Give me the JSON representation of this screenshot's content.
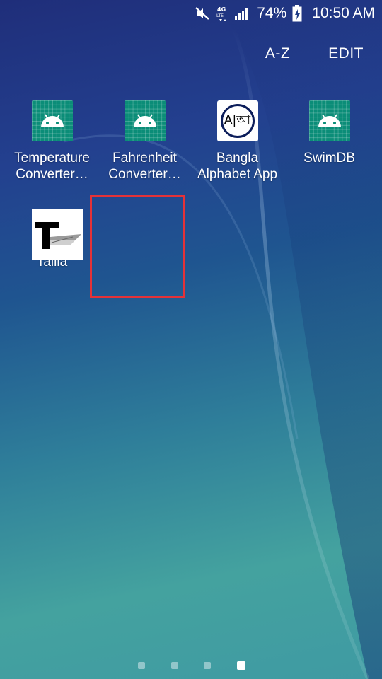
{
  "status_bar": {
    "mute_icon": "mute-icon",
    "network_label": "4G LTE",
    "signal_icon": "signal-icon",
    "battery_percent": "74%",
    "battery_icon": "battery-charging-icon",
    "time": "10:50 AM"
  },
  "top_actions": {
    "sort_label": "A-Z",
    "edit_label": "EDIT"
  },
  "apps": [
    {
      "line1": "Temperature",
      "line2": "Converter…",
      "icon": "android-icon"
    },
    {
      "line1": "Fahrenheit",
      "line2": "Converter…",
      "icon": "android-icon"
    },
    {
      "line1": "Bangla",
      "line2": "Alphabet App",
      "icon": "bangla-icon",
      "icon_text": "A|আ"
    },
    {
      "line1": "SwimDB",
      "line2": "",
      "icon": "android-icon"
    },
    {
      "line1": "Tallia",
      "line2": "",
      "icon": "tallia-logo-icon"
    }
  ],
  "page_indicator": {
    "total_pages": 4,
    "current_page": 4
  },
  "colors": {
    "highlight": "#e53238",
    "android_tile": "#0b8d78"
  }
}
